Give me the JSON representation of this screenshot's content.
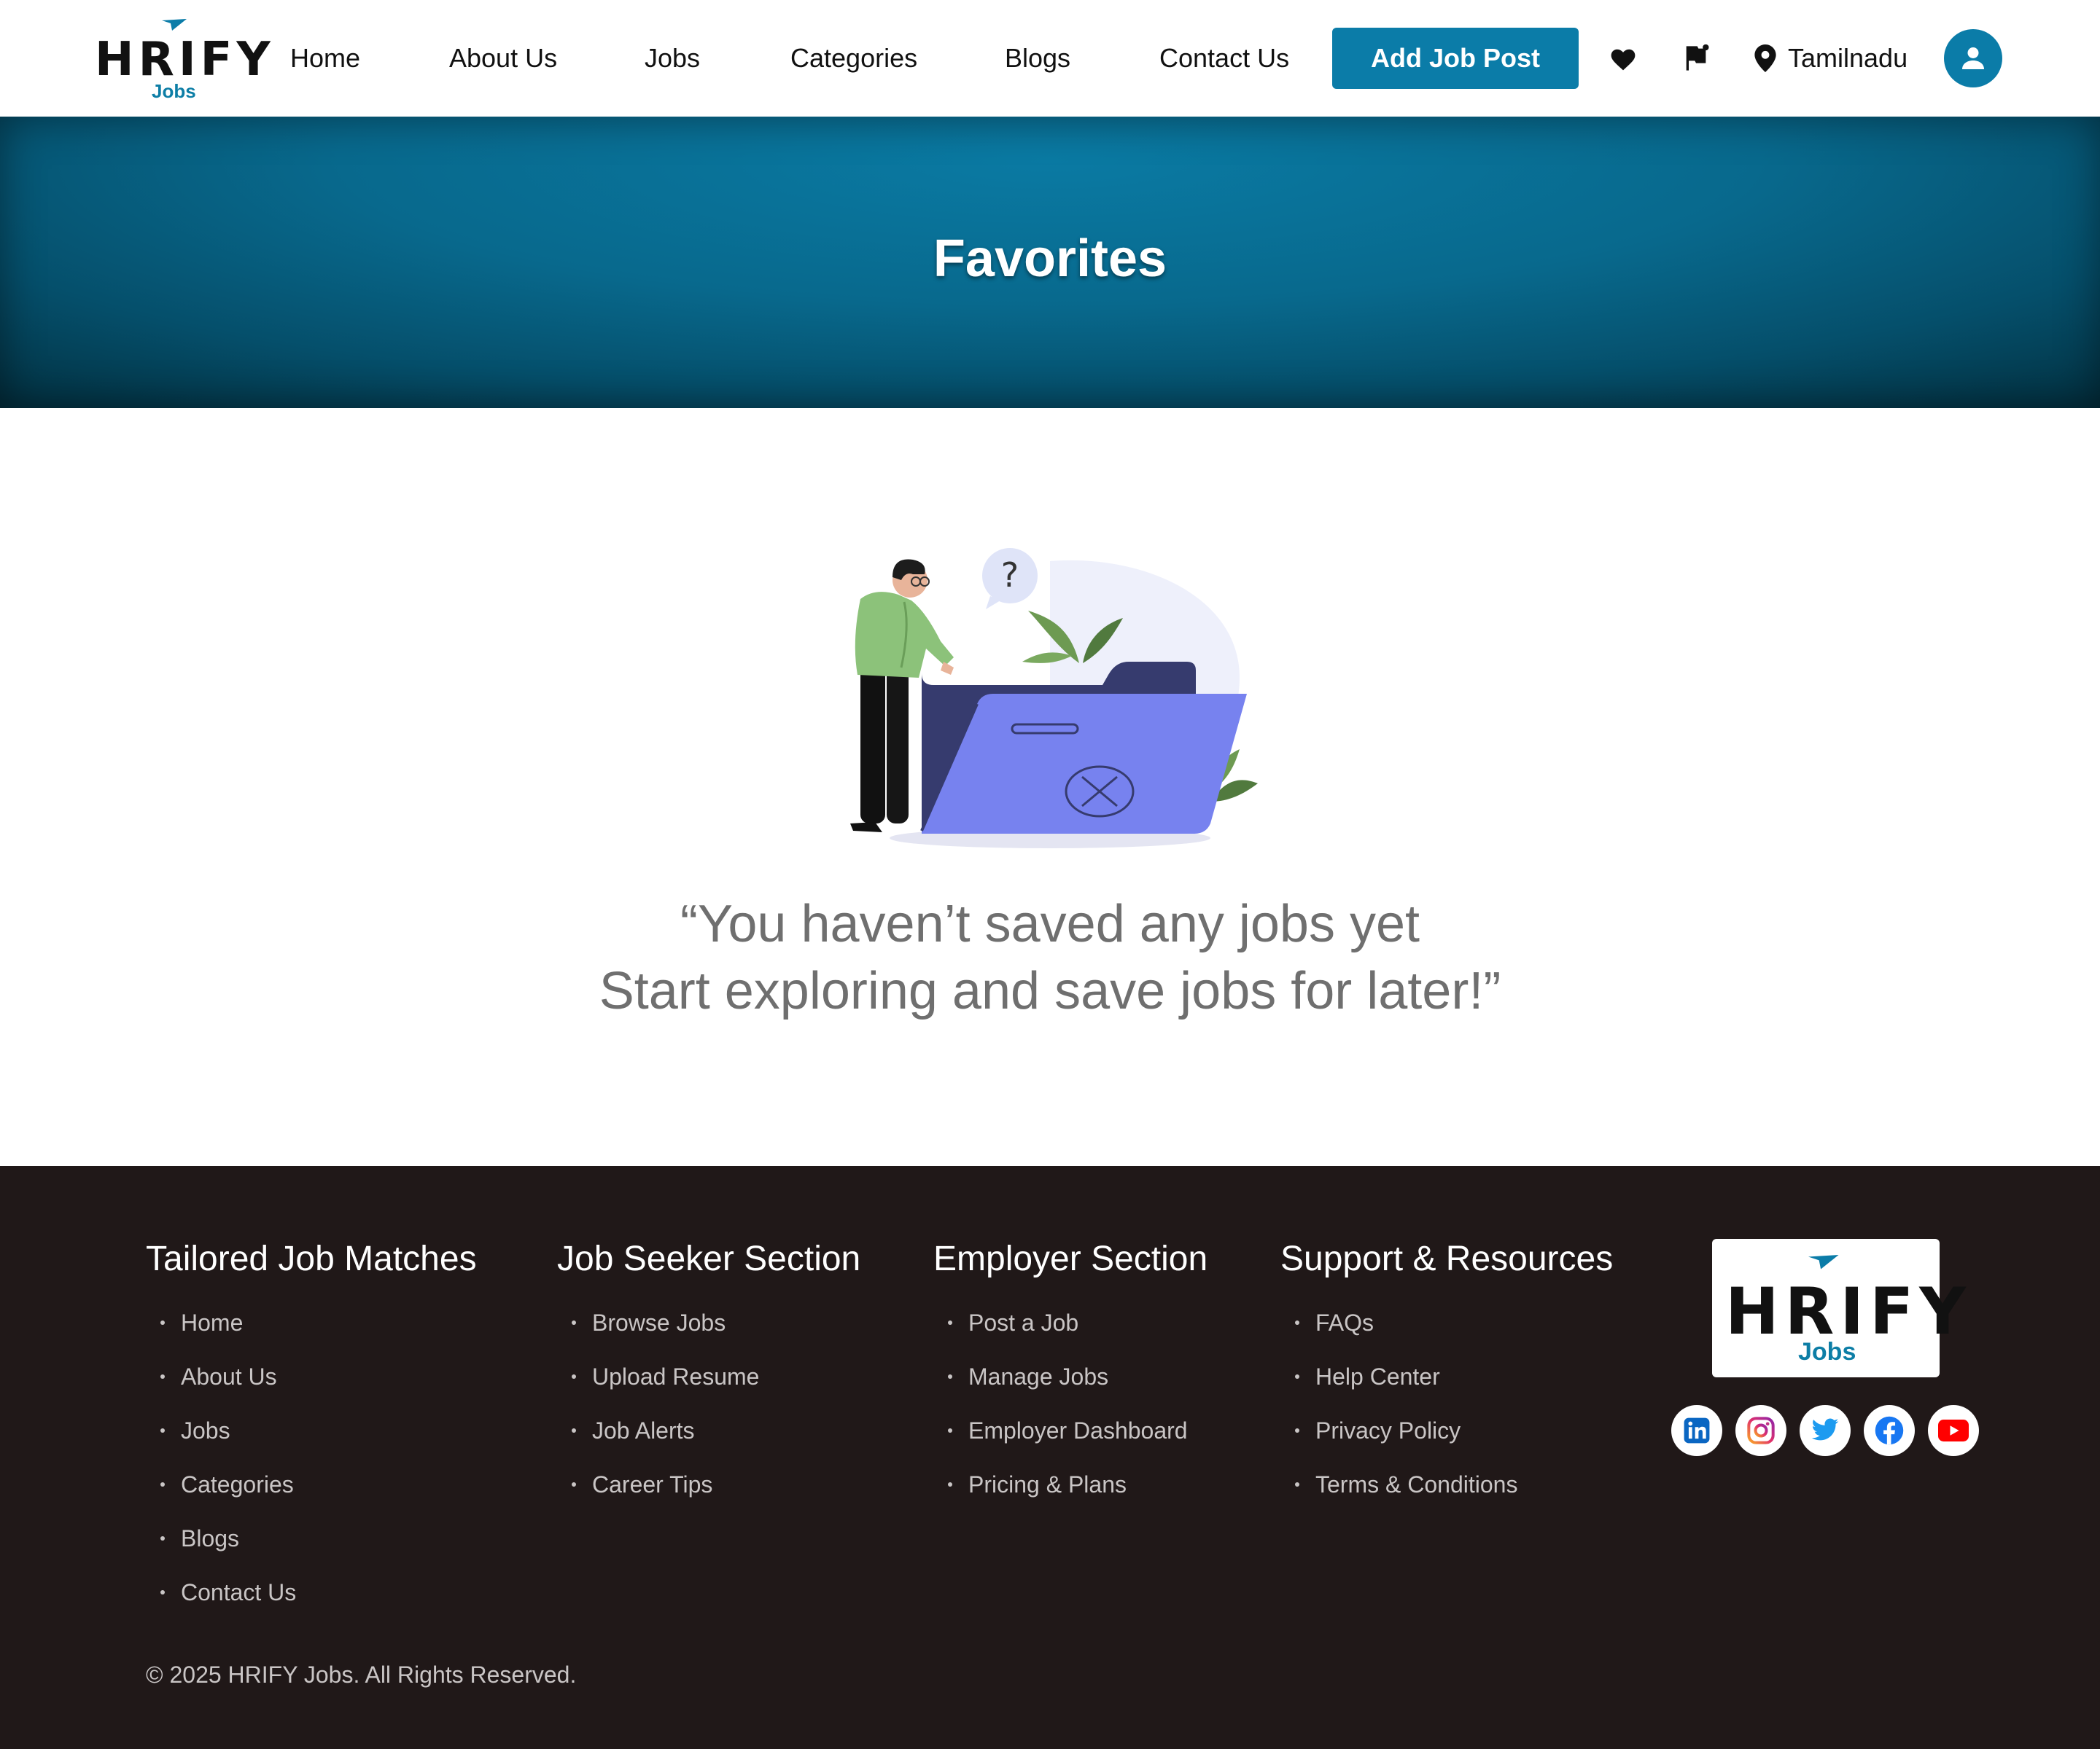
{
  "brand": {
    "name": "HRIFY",
    "sub": "Jobs",
    "accent_color": "#0b7ca8",
    "footer_bg": "#201818"
  },
  "nav": {
    "items": [
      "Home",
      "About Us",
      "Jobs",
      "Categories",
      "Blogs",
      "Contact Us"
    ],
    "add_job_label": "Add Job Post",
    "location": "Tamilnadu",
    "icons": [
      "heart-icon",
      "flag-icon",
      "location-pin-icon",
      "user-icon"
    ]
  },
  "banner": {
    "title": "Favorites"
  },
  "empty_state": {
    "line1": "“You haven’t saved any jobs yet",
    "line2": "Start exploring and save jobs for later!”",
    "illustration_bubble": "?"
  },
  "footer": {
    "columns": [
      {
        "title": "Tailored Job Matches",
        "links": [
          "Home",
          "About Us",
          "Jobs",
          "Categories",
          "Blogs",
          "Contact Us"
        ]
      },
      {
        "title": "Job Seeker Section",
        "links": [
          "Browse Jobs",
          "Upload Resume",
          "Job Alerts",
          "Career Tips"
        ]
      },
      {
        "title": "Employer Section",
        "links": [
          "Post a Job",
          "Manage Jobs",
          "Employer Dashboard",
          "Pricing & Plans"
        ]
      },
      {
        "title": "Support & Resources",
        "links": [
          "FAQs",
          "Help Center",
          "Privacy Policy",
          "Terms & Conditions"
        ]
      }
    ],
    "social": [
      "linkedin-icon",
      "instagram-icon",
      "twitter-icon",
      "facebook-icon",
      "youtube-icon"
    ],
    "copyright": "© 2025 HRIFY Jobs. All Rights Reserved."
  }
}
